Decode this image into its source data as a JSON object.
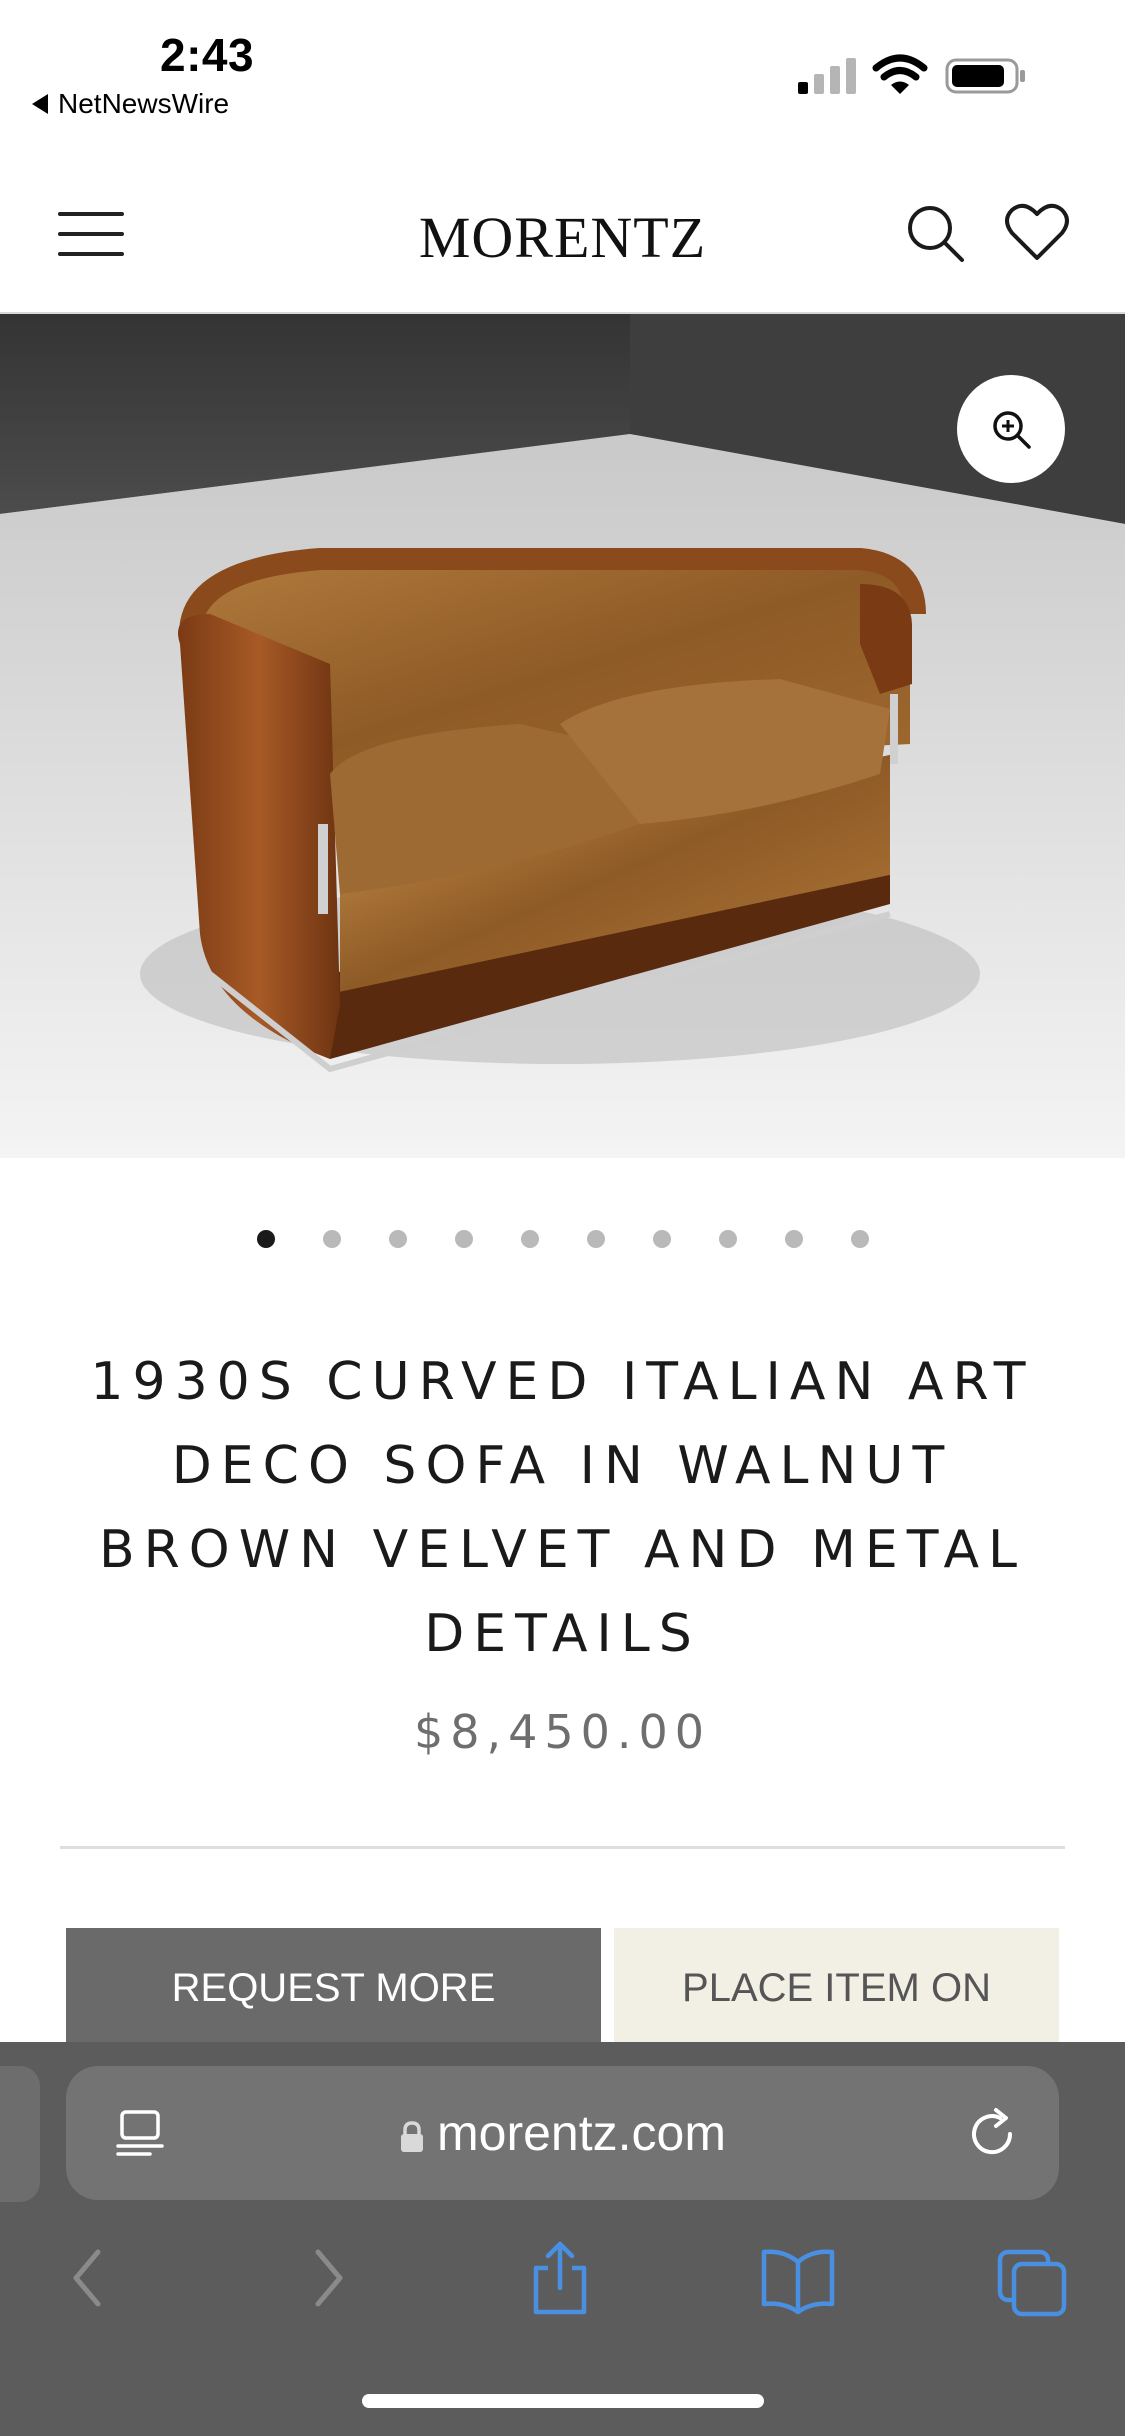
{
  "status_bar": {
    "time": "2:43",
    "back_app": "NetNewsWire"
  },
  "header": {
    "brand": "MORENTZ"
  },
  "gallery": {
    "total_images": 10,
    "active_index": 0
  },
  "product": {
    "title": "1930S CURVED ITALIAN ART DECO SOFA IN WALNUT BROWN VELVET AND METAL DETAILS",
    "price": "$8,450.00"
  },
  "actions": {
    "request_label": "REQUEST MORE",
    "place_label": "PLACE ITEM ON"
  },
  "browser": {
    "url": "morentz.com"
  },
  "colors": {
    "safari_toolbar": "#5c5c5c",
    "url_bar": "#737373",
    "toolbar_icon_blue": "#4a90e2",
    "request_button": "#6a6a6a",
    "place_button": "#f2efe5"
  }
}
